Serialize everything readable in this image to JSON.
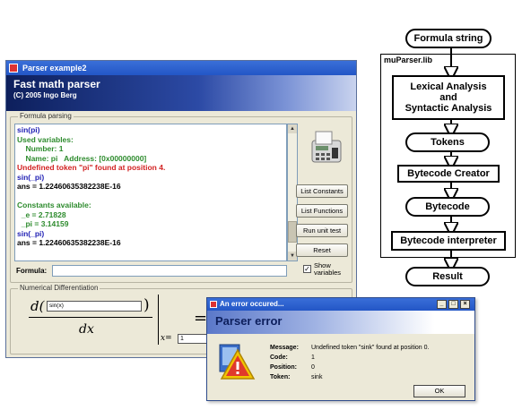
{
  "main_window": {
    "title": "Parser example2",
    "banner_title": "Fast math parser",
    "banner_subtitle": "(C) 2005 Ingo Berg",
    "formula_group_label": "Formula parsing",
    "output_lines": [
      {
        "text": "sin(pi)",
        "color": "#1f1fb4"
      },
      {
        "text": "Used variables:",
        "color": "#2d8b2d"
      },
      {
        "text": "    Number: 1",
        "color": "#2d8b2d"
      },
      {
        "text": "    Name: pi   Address: [0x00000000]",
        "color": "#2d8b2d"
      },
      {
        "text": "Undefined token \"pi\" found at position 4.",
        "color": "#d22222"
      },
      {
        "text": "sin(_pi)",
        "color": "#1f1fb4"
      },
      {
        "text": "ans = 1.22460635382238E-16",
        "color": "#000000"
      },
      {
        "text": "",
        "color": "#000000"
      },
      {
        "text": "Constants available:",
        "color": "#2d8b2d"
      },
      {
        "text": "  _e = 2.71828",
        "color": "#2d8b2d"
      },
      {
        "text": "  _pi = 3.14159",
        "color": "#2d8b2d"
      },
      {
        "text": "sin(_pi)",
        "color": "#1f1fb4"
      },
      {
        "text": "ans = 1.22460635382238E-16",
        "color": "#000000"
      }
    ],
    "buttons": {
      "list_constants": "List Constants",
      "list_functions": "List Functions",
      "run_unit_test": "Run unit test",
      "reset": "Reset"
    },
    "formula_label": "Formula:",
    "formula_value": "",
    "show_variables_label": "Show variables",
    "show_variables_checked": true,
    "diff_group_label": "Numerical Differentiation",
    "diff": {
      "d": "d(",
      "expression": "sin(x)",
      "close_paren": ")",
      "dx": "dx",
      "x_eq": "x=",
      "x_value": "1",
      "equals": "="
    }
  },
  "error_dialog": {
    "title": "An error occured...",
    "heading": "Parser error",
    "fields": [
      {
        "key": "Message:",
        "value": "Undefined token \"sink\" found at position 0."
      },
      {
        "key": "Code:",
        "value": "1"
      },
      {
        "key": "Position:",
        "value": "0"
      },
      {
        "key": "Token:",
        "value": "sink"
      }
    ],
    "ok_label": "OK",
    "window_buttons": [
      "_",
      "□",
      "×"
    ]
  },
  "flow_diagram": {
    "start": "Formula string",
    "library_label": "muParser.lib",
    "steps": [
      "Lexical Analysis\nand\nSyntactic Analysis",
      "Tokens",
      "Bytecode Creator",
      "Bytecode",
      "Bytecode interpreter"
    ],
    "end": "Result"
  }
}
